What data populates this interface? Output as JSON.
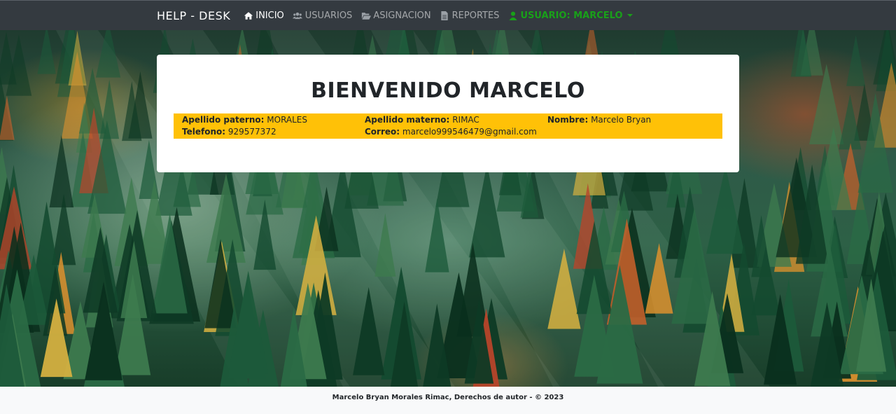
{
  "nav": {
    "brand": "HELP - DESK",
    "items": [
      {
        "label": "INICIO",
        "icon": "home-icon",
        "active": true
      },
      {
        "label": "USUARIOS",
        "icon": "users-icon",
        "active": false
      },
      {
        "label": "ASIGNACION",
        "icon": "folder-open-icon",
        "active": false
      },
      {
        "label": "REPORTES",
        "icon": "file-icon",
        "active": false
      }
    ],
    "user_menu": {
      "label": "USUARIO: MARCELO",
      "icon": "user-icon",
      "color": "#19a019"
    }
  },
  "card": {
    "title": "BIENVENIDO MARCELO",
    "info": {
      "apellido_paterno": {
        "label": "Apellido paterno:",
        "value": "MORALES"
      },
      "apellido_materno": {
        "label": "Apellido materno:",
        "value": "RIMAC"
      },
      "nombre": {
        "label": "Nombre:",
        "value": "Marcelo Bryan"
      },
      "telefono": {
        "label": "Telefono:",
        "value": "929577372"
      },
      "correo": {
        "label": "Correo:",
        "value": "marcelo999546479@gmail.com"
      }
    },
    "info_bg": "#ffc107"
  },
  "footer": {
    "text": "Marcelo Bryan Morales Rimac, Derechos de autor - © 2023"
  },
  "colors": {
    "navbar": "#343a40",
    "accent_user": "#19a019",
    "info_banner": "#ffc107"
  }
}
